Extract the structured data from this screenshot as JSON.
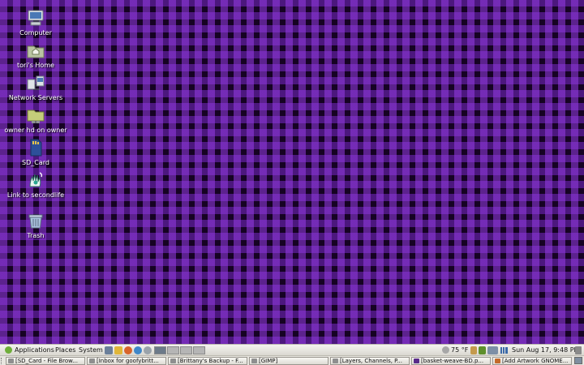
{
  "desktop": {
    "icons": [
      {
        "label": "Computer",
        "icon": "computer-icon"
      },
      {
        "label": "tori's Home",
        "icon": "home-folder-icon"
      },
      {
        "label": "Network Servers",
        "icon": "network-servers-icon"
      },
      {
        "label": "owner hd on owner",
        "icon": "network-drive-icon"
      },
      {
        "label": "SD_Card",
        "icon": "sd-card-icon"
      },
      {
        "label": "Link to secondlife",
        "icon": "secondlife-icon"
      },
      {
        "label": "Trash",
        "icon": "trash-icon"
      }
    ]
  },
  "top_panel": {
    "menus": [
      "Applications",
      "Places",
      "System"
    ],
    "weather": "75 °F",
    "clock": "Sun Aug 17,  9:48 PM"
  },
  "taskbar": {
    "tasks": [
      {
        "label": "[SD_Card - File Brow..."
      },
      {
        "label": "[Inbox for goofybritt..."
      },
      {
        "label": "[Brittany's Backup - F..."
      },
      {
        "label": "[GIMP]"
      },
      {
        "label": "[Layers, Channels, P..."
      },
      {
        "label": "[basket-weave-BD.p..."
      },
      {
        "label": "[Add Artwork GNOME..."
      }
    ]
  },
  "colors": {
    "desktop_bg": "#160323",
    "weave_accent": "#9b3ce6",
    "panel_bg": "#e7e5df"
  }
}
